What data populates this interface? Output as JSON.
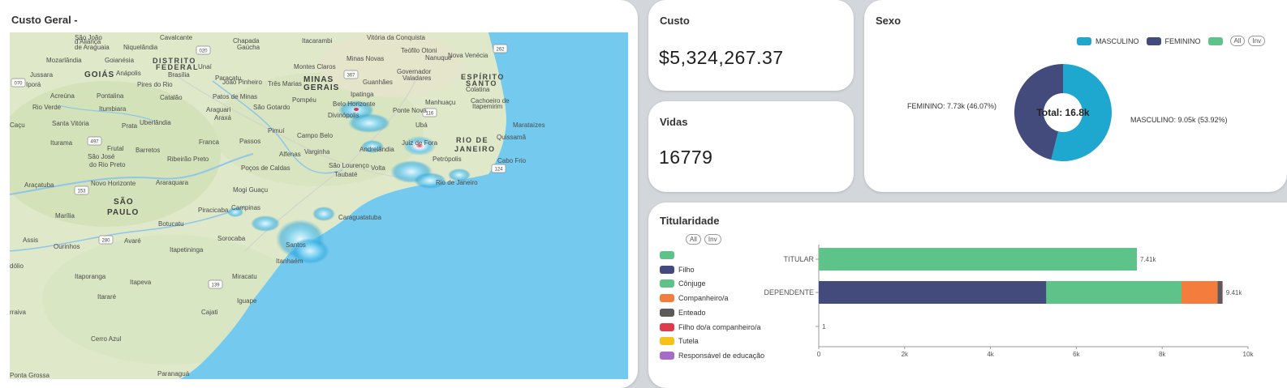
{
  "colors": {
    "masculino": "#1fa8cf",
    "feminino": "#424b7c",
    "green": "#5dc389",
    "filho": "#424b7c",
    "conjuge": "#5dc389",
    "companheiro": "#f47c3c",
    "enteado": "#5b5b5b",
    "filho_companheiro": "#e03b4c",
    "tutela": "#f4c21a",
    "responsavel": "#a56cc8"
  },
  "map_card": {
    "title": "Custo Geral -",
    "places": [
      {
        "name": "Vitória da Conquista",
        "cls": ""
      },
      {
        "name": "Cavalcante",
        "cls": ""
      },
      {
        "name": "São João",
        "cls": ""
      },
      {
        "name": "d'Aliança",
        "cls": ""
      },
      {
        "name": "de Araguaia",
        "cls": ""
      },
      {
        "name": "Niquelândia",
        "cls": ""
      },
      {
        "name": "Chapada",
        "cls": ""
      },
      {
        "name": "Gaúcha",
        "cls": ""
      },
      {
        "name": "Itacarambi",
        "cls": ""
      },
      {
        "name": "Teófilo Otoni",
        "cls": ""
      },
      {
        "name": "Mozarlândia",
        "cls": ""
      },
      {
        "name": "Goianésia",
        "cls": ""
      },
      {
        "name": "DISTRITO",
        "cls": "state"
      },
      {
        "name": "FEDERAL",
        "cls": "state"
      },
      {
        "name": "Unaí",
        "cls": ""
      },
      {
        "name": "Montes Claros",
        "cls": ""
      },
      {
        "name": "Minas Novas",
        "cls": ""
      },
      {
        "name": "Nanuque",
        "cls": ""
      },
      {
        "name": "Nova Venécia",
        "cls": ""
      },
      {
        "name": "Jussara",
        "cls": ""
      },
      {
        "name": "GOIÁS",
        "cls": "big"
      },
      {
        "name": "Anápolis",
        "cls": ""
      },
      {
        "name": "Brasília",
        "cls": ""
      },
      {
        "name": "Paracatu",
        "cls": ""
      },
      {
        "name": "MINAS",
        "cls": "big"
      },
      {
        "name": "GERAIS",
        "cls": "big"
      },
      {
        "name": "Governador",
        "cls": ""
      },
      {
        "name": "Valadares",
        "cls": ""
      },
      {
        "name": "ESPÍRITO",
        "cls": "state"
      },
      {
        "name": "SANTO",
        "cls": "state"
      },
      {
        "name": "Iporá",
        "cls": ""
      },
      {
        "name": "Pires do Rio",
        "cls": ""
      },
      {
        "name": "João Pinheiro",
        "cls": ""
      },
      {
        "name": "Três Marias",
        "cls": ""
      },
      {
        "name": "Guanhães",
        "cls": ""
      },
      {
        "name": "Colatina",
        "cls": ""
      },
      {
        "name": "Acreúna",
        "cls": ""
      },
      {
        "name": "Pontalina",
        "cls": ""
      },
      {
        "name": "Catalão",
        "cls": ""
      },
      {
        "name": "Patos de Minas",
        "cls": ""
      },
      {
        "name": "Pompéu",
        "cls": ""
      },
      {
        "name": "Ipatinga",
        "cls": ""
      },
      {
        "name": "Manhuaçu",
        "cls": ""
      },
      {
        "name": "Cachoeiro de",
        "cls": ""
      },
      {
        "name": "Itapemirim",
        "cls": ""
      },
      {
        "name": "Rio Verde",
        "cls": ""
      },
      {
        "name": "Itumbiara",
        "cls": ""
      },
      {
        "name": "Araguari",
        "cls": ""
      },
      {
        "name": "São Gotardo",
        "cls": ""
      },
      {
        "name": "Belo Horizonte",
        "cls": ""
      },
      {
        "name": "Ponte Nova",
        "cls": ""
      },
      {
        "name": "Caçu",
        "cls": ""
      },
      {
        "name": "Santa Vitória",
        "cls": ""
      },
      {
        "name": "Prata",
        "cls": ""
      },
      {
        "name": "Uberlândia",
        "cls": ""
      },
      {
        "name": "Araxá",
        "cls": ""
      },
      {
        "name": "Divinópolis",
        "cls": ""
      },
      {
        "name": "Ubá",
        "cls": ""
      },
      {
        "name": "Marataízes",
        "cls": ""
      },
      {
        "name": "Pimuí",
        "cls": ""
      },
      {
        "name": "Iturama",
        "cls": ""
      },
      {
        "name": "Frutal",
        "cls": ""
      },
      {
        "name": "Franca",
        "cls": ""
      },
      {
        "name": "Passos",
        "cls": ""
      },
      {
        "name": "Campo Belo",
        "cls": ""
      },
      {
        "name": "Juiz de Fora",
        "cls": ""
      },
      {
        "name": "RIO DE",
        "cls": "state"
      },
      {
        "name": "JANEIRO",
        "cls": "state"
      },
      {
        "name": "Quissamã",
        "cls": ""
      },
      {
        "name": "São José",
        "cls": ""
      },
      {
        "name": "do Rio Preto",
        "cls": ""
      },
      {
        "name": "Barretos",
        "cls": ""
      },
      {
        "name": "Ribeirão Preto",
        "cls": ""
      },
      {
        "name": "Alfenas",
        "cls": ""
      },
      {
        "name": "Varginha",
        "cls": ""
      },
      {
        "name": "Andrelândia",
        "cls": ""
      },
      {
        "name": "Petrópolis",
        "cls": ""
      },
      {
        "name": "Cabo Frio",
        "cls": ""
      },
      {
        "name": "Poços de Caldas",
        "cls": ""
      },
      {
        "name": "São Lourenço",
        "cls": ""
      },
      {
        "name": "Volta",
        "cls": ""
      },
      {
        "name": "Rio de Janeiro",
        "cls": ""
      },
      {
        "name": "Araçatuba",
        "cls": ""
      },
      {
        "name": "Novo Horizonte",
        "cls": ""
      },
      {
        "name": "Araraquara",
        "cls": ""
      },
      {
        "name": "Mogi Guaçu",
        "cls": ""
      },
      {
        "name": "Taubaté",
        "cls": ""
      },
      {
        "name": "SÃO",
        "cls": "big"
      },
      {
        "name": "PAULO",
        "cls": "big"
      },
      {
        "name": "Piracicaba",
        "cls": ""
      },
      {
        "name": "Campinas",
        "cls": ""
      },
      {
        "name": "Caraguatatuba",
        "cls": ""
      },
      {
        "name": "Marília",
        "cls": ""
      },
      {
        "name": "Botucatu",
        "cls": ""
      },
      {
        "name": "Assis",
        "cls": ""
      },
      {
        "name": "Ourinhos",
        "cls": ""
      },
      {
        "name": "Avaré",
        "cls": ""
      },
      {
        "name": "Sorocaba",
        "cls": ""
      },
      {
        "name": "Itapetininga",
        "cls": ""
      },
      {
        "name": "Santos",
        "cls": ""
      },
      {
        "name": "Itanhaém",
        "cls": ""
      },
      {
        "name": "dólio",
        "cls": ""
      },
      {
        "name": "Itaporanga",
        "cls": ""
      },
      {
        "name": "Itapeva",
        "cls": ""
      },
      {
        "name": "Miracatu",
        "cls": ""
      },
      {
        "name": "Itararé",
        "cls": ""
      },
      {
        "name": "Iguape",
        "cls": ""
      },
      {
        "name": "rraiva",
        "cls": ""
      },
      {
        "name": "Cajati",
        "cls": ""
      },
      {
        "name": "Cerro Azul",
        "cls": ""
      },
      {
        "name": "Ponta Grossa",
        "cls": ""
      },
      {
        "name": "Paranaguá",
        "cls": ""
      }
    ],
    "shields": [
      "070",
      "020",
      "497",
      "153",
      "280",
      "139",
      "367",
      "262",
      "116",
      "124"
    ]
  },
  "custo": {
    "title": "Custo",
    "value": "$5,324,267.37"
  },
  "vidas": {
    "title": "Vidas",
    "value": "16779"
  },
  "sexo": {
    "title": "Sexo",
    "legend": {
      "masculino": "MASCULINO",
      "feminino": "FEMININO",
      "all": "All",
      "inv": "Inv"
    },
    "label_feminino": "FEMININO: 7.73k (46.07%)",
    "label_masculino": "MASCULINO: 9.05k (53.92%)",
    "total_label": "Total: 16.8k",
    "chart_data": {
      "type": "pie",
      "categories": [
        "MASCULINO",
        "FEMININO"
      ],
      "values": [
        9050,
        7730
      ],
      "total": 16779
    }
  },
  "titularidade": {
    "title": "Titularidade",
    "all": "All",
    "inv": "Inv",
    "legend": [
      {
        "label": "",
        "color_key": "green"
      },
      {
        "label": "Filho",
        "color_key": "filho"
      },
      {
        "label": "Cônjuge",
        "color_key": "conjuge"
      },
      {
        "label": "Companheiro/a",
        "color_key": "companheiro"
      },
      {
        "label": "Enteado",
        "color_key": "enteado"
      },
      {
        "label": "Filho do/a companheiro/a",
        "color_key": "filho_companheiro"
      },
      {
        "label": "Tutela",
        "color_key": "tutela"
      },
      {
        "label": "Responsável de educação",
        "color_key": "responsavel"
      }
    ],
    "chart_data": {
      "type": "bar",
      "orientation": "horizontal",
      "stacked": true,
      "categories": [
        "TITULAR",
        "DEPENDENTE",
        ""
      ],
      "series": [
        {
          "name": "",
          "values": [
            7410,
            0,
            1
          ],
          "color_key": "green"
        },
        {
          "name": "Filho",
          "values": [
            0,
            5300,
            0
          ],
          "color_key": "filho"
        },
        {
          "name": "Cônjuge",
          "values": [
            0,
            3150,
            0
          ],
          "color_key": "conjuge"
        },
        {
          "name": "Companheiro/a",
          "values": [
            0,
            840,
            0
          ],
          "color_key": "companheiro"
        },
        {
          "name": "Enteado",
          "values": [
            0,
            110,
            0
          ],
          "color_key": "enteado"
        },
        {
          "name": "Filho do/a companheiro/a",
          "values": [
            0,
            10,
            0
          ],
          "color_key": "filho_companheiro"
        }
      ],
      "total_labels": [
        "7.41k",
        "9.41k",
        "1"
      ],
      "xlim": [
        0,
        10000
      ],
      "xticks": [
        0,
        2000,
        4000,
        6000,
        8000,
        10000
      ],
      "xtick_labels": [
        "0",
        "2k",
        "4k",
        "6k",
        "8k",
        "10k"
      ]
    }
  }
}
